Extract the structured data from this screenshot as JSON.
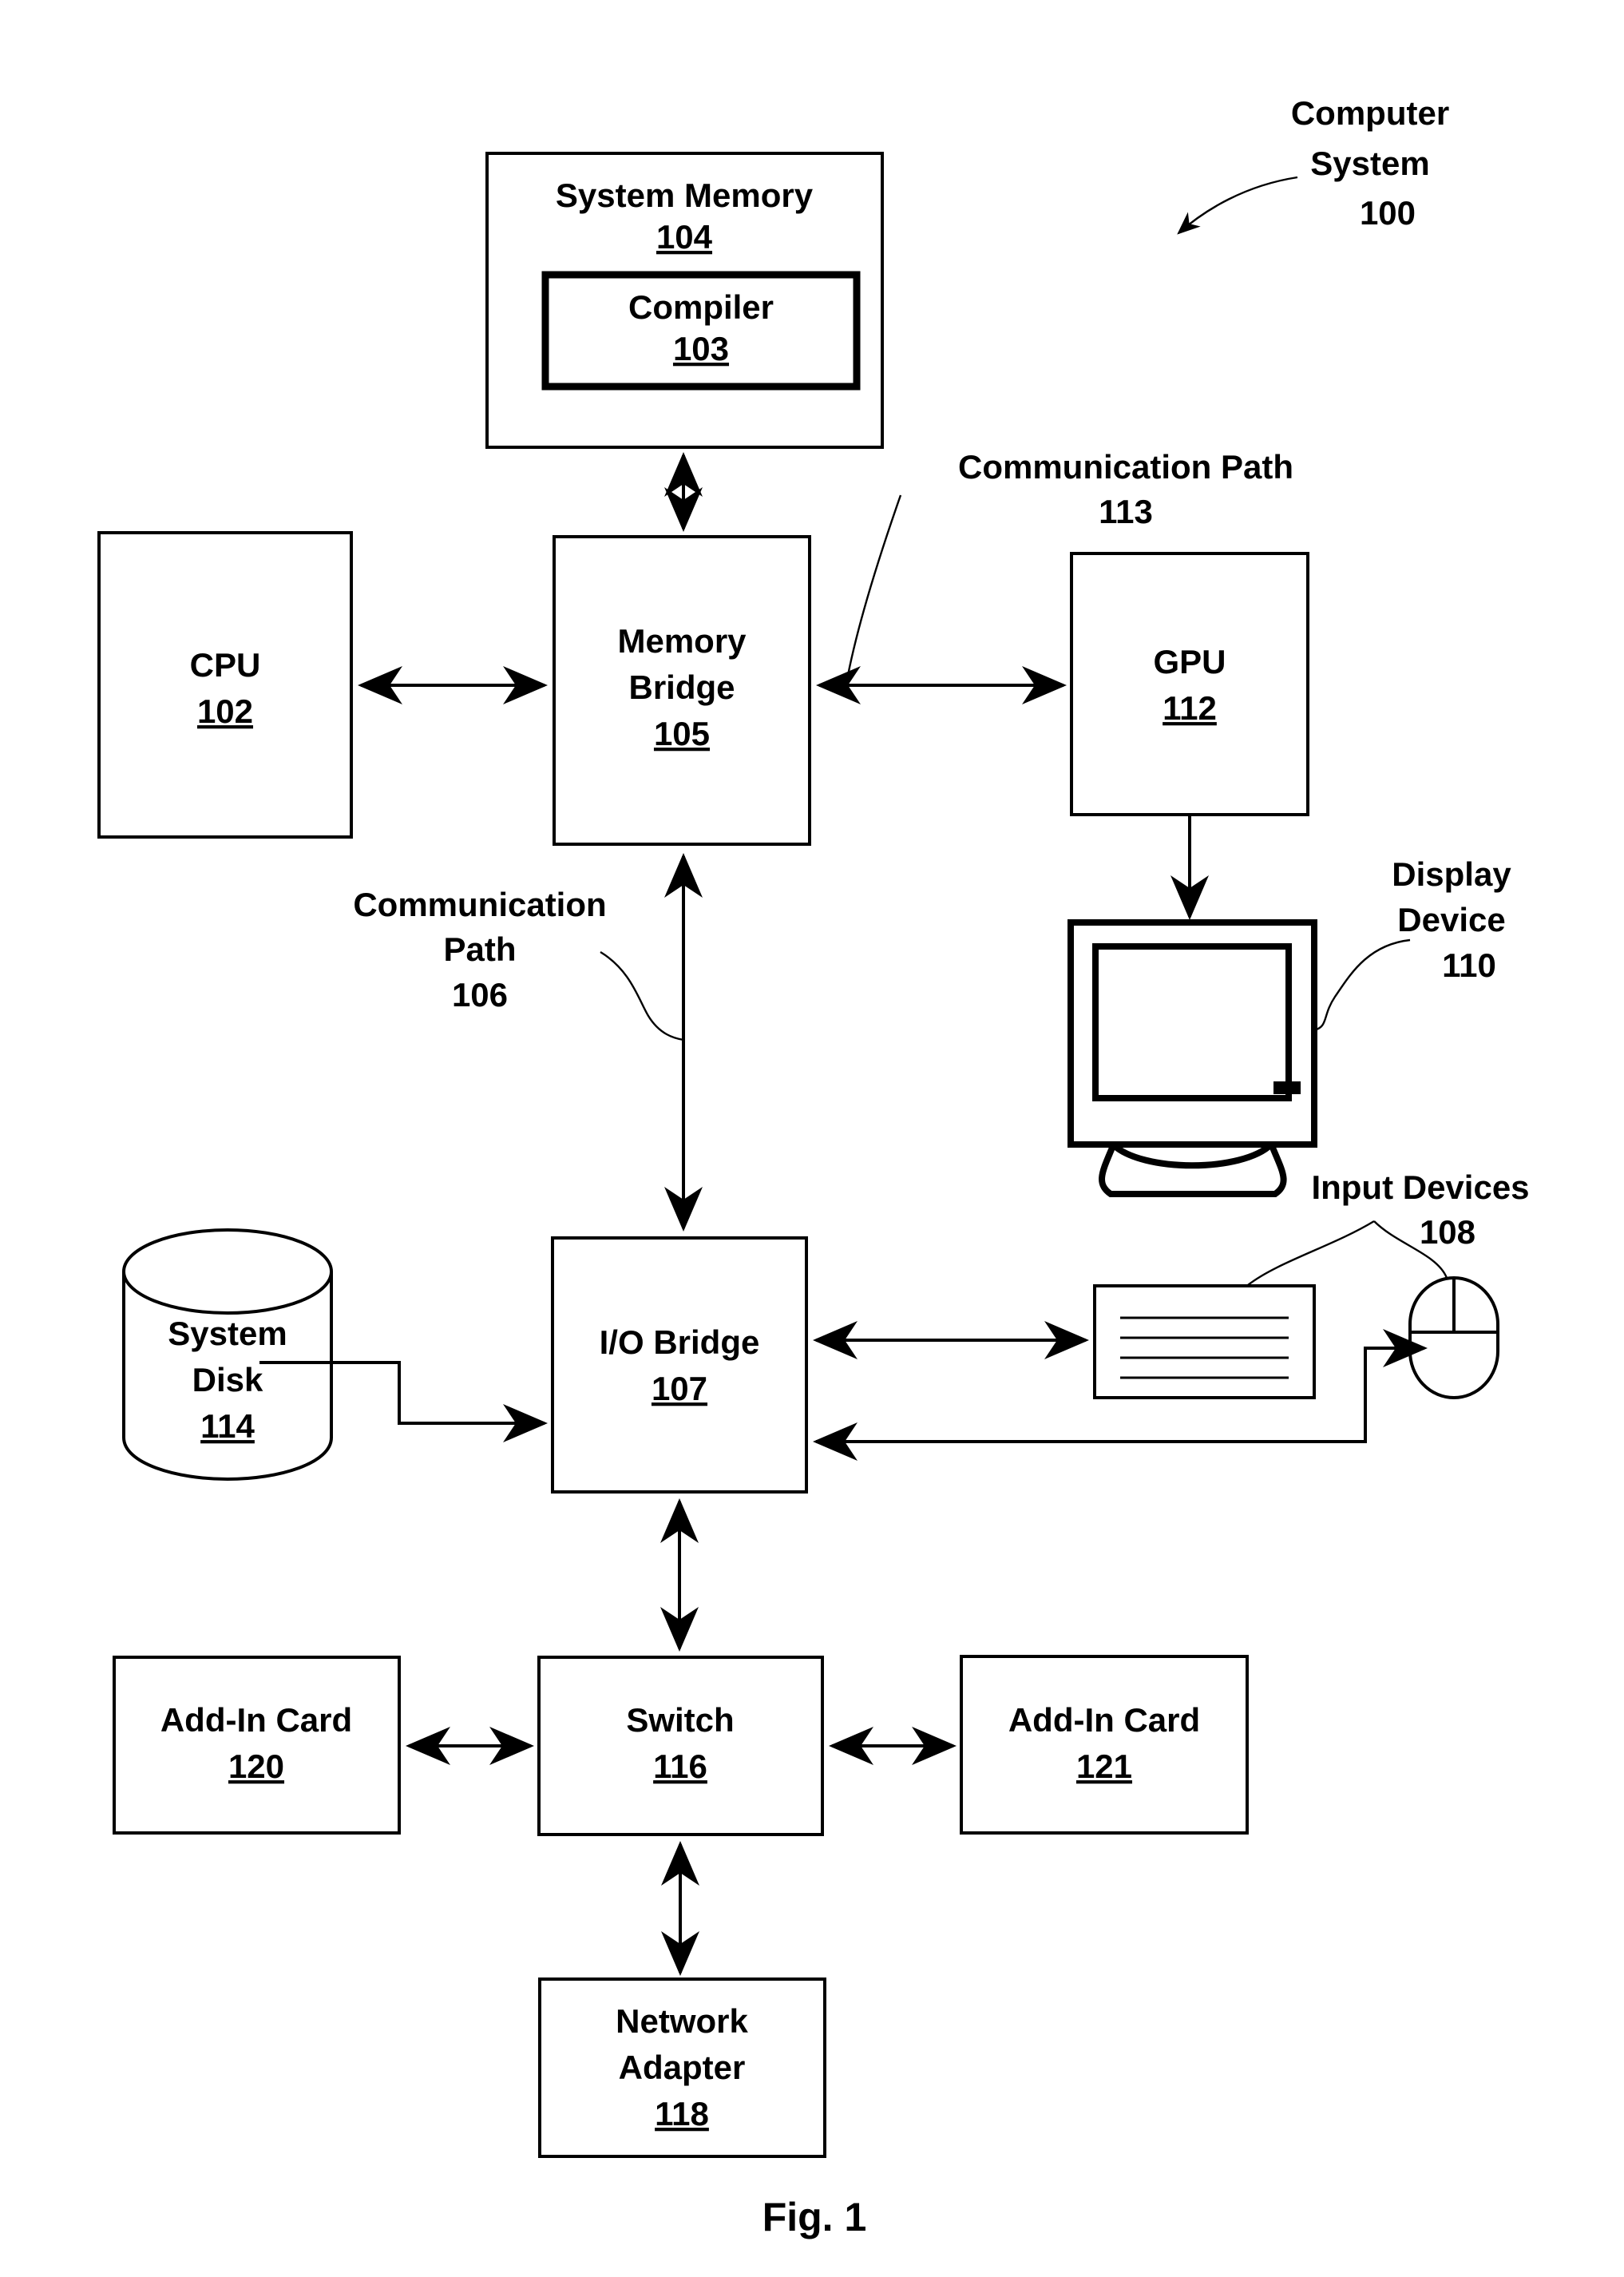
{
  "figure": {
    "caption": "Fig. 1",
    "system_annotation": {
      "line1": "Computer",
      "line2": "System",
      "number": "100"
    }
  },
  "blocks": {
    "system_memory": {
      "title": "System Memory",
      "number": "104"
    },
    "compiler": {
      "title": "Compiler",
      "number": "103"
    },
    "cpu": {
      "title": "CPU",
      "number": "102"
    },
    "memory_bridge": {
      "line1": "Memory",
      "line2": "Bridge",
      "number": "105"
    },
    "gpu": {
      "title": "GPU",
      "number": "112"
    },
    "io_bridge": {
      "title": "I/O Bridge",
      "number": "107"
    },
    "system_disk": {
      "line1": "System",
      "line2": "Disk",
      "number": "114"
    },
    "switch": {
      "title": "Switch",
      "number": "116"
    },
    "add_in_card_left": {
      "title": "Add-In Card",
      "number": "120"
    },
    "add_in_card_right": {
      "title": "Add-In Card",
      "number": "121"
    },
    "network_adapter": {
      "line1": "Network",
      "line2": "Adapter",
      "number": "118"
    }
  },
  "annotations": {
    "comm_path_113": {
      "line1": "Communication Path",
      "number": "113"
    },
    "comm_path_106": {
      "line1": "Communication",
      "line2": "Path",
      "number": "106"
    },
    "display_device": {
      "line1": "Display",
      "line2": "Device",
      "number": "110"
    },
    "input_devices": {
      "line1": "Input Devices",
      "number": "108"
    }
  },
  "icons": {
    "display_device": "monitor-icon",
    "keyboard": "keyboard-icon",
    "mouse": "mouse-icon",
    "system_disk": "cylinder-database-icon"
  },
  "colors": {
    "stroke": "#000000",
    "fill": "#ffffff",
    "text": "#000000"
  }
}
